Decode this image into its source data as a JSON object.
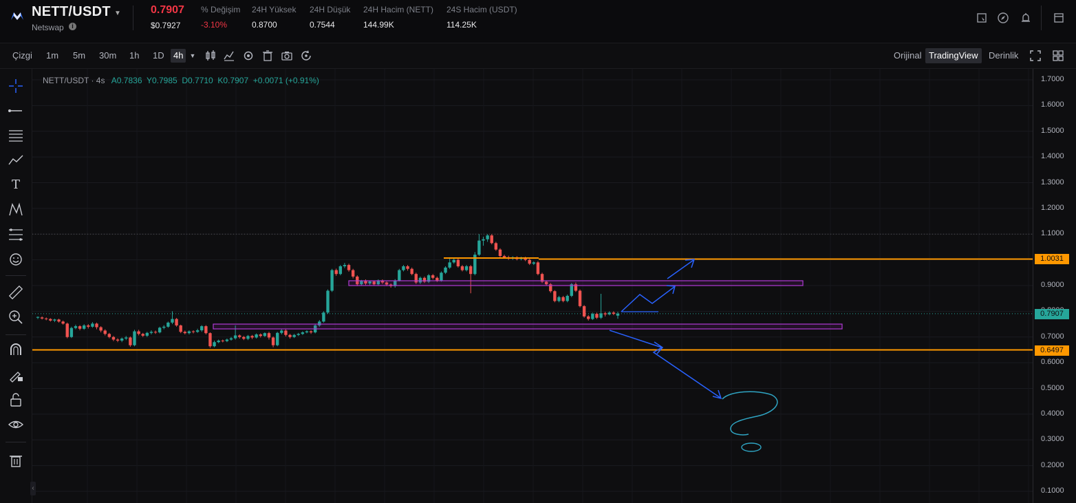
{
  "header": {
    "pair": "NETT/USDT",
    "exchange": "Netswap",
    "price": "0.7907",
    "price_usd": "$0.7927",
    "stats": [
      {
        "label": "% Değişim",
        "value": "-3.10%",
        "color": "#f23645"
      },
      {
        "label": "24H Yüksek",
        "value": "0.8700"
      },
      {
        "label": "24H Düşük",
        "value": "0.7544"
      },
      {
        "label": "24H Hacim (NETT)",
        "value": "144.99K"
      },
      {
        "label": "24S Hacim (USDT)",
        "value": "114.25K"
      }
    ]
  },
  "toolbar": {
    "chart_type": "Çizgi",
    "intervals": [
      "1m",
      "5m",
      "30m",
      "1h",
      "1D",
      "4h"
    ],
    "active_interval": "4h",
    "views": [
      "Orijinal",
      "TradingView",
      "Derinlik"
    ],
    "active_view": "TradingView"
  },
  "legend": {
    "symbol": "NETT/USDT · 4s",
    "open": "A0.7836",
    "high": "Y0.7985",
    "low": "D0.7710",
    "close": "K0.7907",
    "change": "+0.0071 (+0.91%)"
  },
  "chart_data": {
    "type": "candlestick",
    "y_ticks": [
      "1.7000",
      "1.6000",
      "1.5000",
      "1.4000",
      "1.3000",
      "1.2000",
      "1.1000",
      "1.0000",
      "0.9000",
      "0.8000",
      "0.7000",
      "0.6000",
      "0.5000",
      "0.4000",
      "0.3000",
      "0.2000",
      "0.1000"
    ],
    "ylim": [
      0.1,
      1.7
    ],
    "price_badges": [
      {
        "value": 1.0031,
        "label": "1.0031",
        "color": "#ff9800"
      },
      {
        "value": 0.7907,
        "label": "0.7907",
        "color": "#26a69a"
      },
      {
        "value": 0.6497,
        "label": "0.6497",
        "color": "#ff9800"
      }
    ],
    "candles": [
      [
        0.775,
        0.778,
        0.77,
        0.78
      ],
      [
        0.776,
        0.772,
        0.768,
        0.78
      ],
      [
        0.772,
        0.77,
        0.765,
        0.776
      ],
      [
        0.77,
        0.764,
        0.76,
        0.773
      ],
      [
        0.764,
        0.768,
        0.758,
        0.771
      ],
      [
        0.768,
        0.76,
        0.756,
        0.771
      ],
      [
        0.76,
        0.752,
        0.748,
        0.764
      ],
      [
        0.752,
        0.7,
        0.695,
        0.756
      ],
      [
        0.7,
        0.735,
        0.696,
        0.74
      ],
      [
        0.735,
        0.742,
        0.73,
        0.748
      ],
      [
        0.742,
        0.732,
        0.726,
        0.746
      ],
      [
        0.732,
        0.745,
        0.728,
        0.75
      ],
      [
        0.745,
        0.74,
        0.733,
        0.75
      ],
      [
        0.74,
        0.752,
        0.736,
        0.758
      ],
      [
        0.752,
        0.738,
        0.73,
        0.756
      ],
      [
        0.738,
        0.725,
        0.718,
        0.742
      ],
      [
        0.725,
        0.712,
        0.706,
        0.73
      ],
      [
        0.712,
        0.7,
        0.695,
        0.716
      ],
      [
        0.7,
        0.69,
        0.684,
        0.704
      ],
      [
        0.69,
        0.686,
        0.68,
        0.695
      ],
      [
        0.686,
        0.694,
        0.68,
        0.698
      ],
      [
        0.694,
        0.698,
        0.688,
        0.704
      ],
      [
        0.698,
        0.668,
        0.662,
        0.702
      ],
      [
        0.668,
        0.722,
        0.664,
        0.728
      ],
      [
        0.722,
        0.712,
        0.706,
        0.728
      ],
      [
        0.712,
        0.705,
        0.7,
        0.716
      ],
      [
        0.705,
        0.716,
        0.7,
        0.72
      ],
      [
        0.716,
        0.72,
        0.71,
        0.726
      ],
      [
        0.72,
        0.718,
        0.712,
        0.725
      ],
      [
        0.718,
        0.736,
        0.714,
        0.74
      ],
      [
        0.736,
        0.74,
        0.73,
        0.746
      ],
      [
        0.74,
        0.756,
        0.736,
        0.76
      ],
      [
        0.756,
        0.77,
        0.75,
        0.8
      ],
      [
        0.77,
        0.745,
        0.74,
        0.774
      ],
      [
        0.745,
        0.72,
        0.715,
        0.748
      ],
      [
        0.72,
        0.715,
        0.71,
        0.725
      ],
      [
        0.715,
        0.722,
        0.71,
        0.726
      ],
      [
        0.722,
        0.72,
        0.714,
        0.726
      ],
      [
        0.72,
        0.726,
        0.716,
        0.732
      ],
      [
        0.726,
        0.742,
        0.72,
        0.746
      ],
      [
        0.742,
        0.715,
        0.71,
        0.746
      ],
      [
        0.715,
        0.664,
        0.658,
        0.718
      ],
      [
        0.664,
        0.68,
        0.66,
        0.686
      ],
      [
        0.68,
        0.686,
        0.676,
        0.69
      ],
      [
        0.686,
        0.684,
        0.679,
        0.69
      ],
      [
        0.684,
        0.69,
        0.68,
        0.694
      ],
      [
        0.69,
        0.695,
        0.686,
        0.7
      ],
      [
        0.695,
        0.706,
        0.69,
        0.745
      ],
      [
        0.706,
        0.7,
        0.694,
        0.71
      ],
      [
        0.7,
        0.693,
        0.688,
        0.704
      ],
      [
        0.693,
        0.704,
        0.688,
        0.708
      ],
      [
        0.704,
        0.698,
        0.692,
        0.708
      ],
      [
        0.698,
        0.71,
        0.694,
        0.714
      ],
      [
        0.71,
        0.704,
        0.698,
        0.714
      ],
      [
        0.704,
        0.715,
        0.7,
        0.718
      ],
      [
        0.715,
        0.698,
        0.69,
        0.72
      ],
      [
        0.698,
        0.668,
        0.66,
        0.702
      ],
      [
        0.668,
        0.716,
        0.664,
        0.72
      ],
      [
        0.716,
        0.725,
        0.71,
        0.73
      ],
      [
        0.725,
        0.708,
        0.702,
        0.73
      ],
      [
        0.708,
        0.7,
        0.694,
        0.712
      ],
      [
        0.7,
        0.708,
        0.696,
        0.712
      ],
      [
        0.708,
        0.712,
        0.704,
        0.716
      ],
      [
        0.712,
        0.718,
        0.708,
        0.722
      ],
      [
        0.718,
        0.722,
        0.714,
        0.726
      ],
      [
        0.722,
        0.718,
        0.712,
        0.726
      ],
      [
        0.718,
        0.745,
        0.714,
        0.75
      ],
      [
        0.745,
        0.76,
        0.74,
        0.766
      ],
      [
        0.76,
        0.795,
        0.756,
        0.8
      ],
      [
        0.795,
        0.88,
        0.79,
        0.885
      ],
      [
        0.88,
        0.96,
        0.875,
        0.965
      ],
      [
        0.96,
        0.945,
        0.938,
        0.966
      ],
      [
        0.945,
        0.975,
        0.94,
        0.98
      ],
      [
        0.975,
        0.98,
        0.968,
        0.988
      ],
      [
        0.98,
        0.96,
        0.954,
        0.985
      ],
      [
        0.96,
        0.935,
        0.928,
        0.965
      ],
      [
        0.935,
        0.905,
        0.898,
        0.94
      ],
      [
        0.905,
        0.918,
        0.9,
        0.922
      ],
      [
        0.918,
        0.908,
        0.902,
        0.924
      ],
      [
        0.908,
        0.916,
        0.902,
        0.92
      ],
      [
        0.916,
        0.905,
        0.9,
        0.92
      ],
      [
        0.905,
        0.92,
        0.9,
        0.924
      ],
      [
        0.92,
        0.912,
        0.906,
        0.924
      ],
      [
        0.912,
        0.904,
        0.898,
        0.916
      ],
      [
        0.904,
        0.898,
        0.892,
        0.908
      ],
      [
        0.898,
        0.92,
        0.892,
        0.925
      ],
      [
        0.92,
        0.96,
        0.916,
        0.965
      ],
      [
        0.96,
        0.975,
        0.955,
        0.98
      ],
      [
        0.975,
        0.965,
        0.958,
        0.98
      ],
      [
        0.965,
        0.945,
        0.94,
        0.97
      ],
      [
        0.945,
        0.912,
        0.906,
        0.95
      ],
      [
        0.912,
        0.93,
        0.906,
        0.935
      ],
      [
        0.93,
        0.915,
        0.91,
        0.935
      ],
      [
        0.915,
        0.94,
        0.91,
        0.945
      ],
      [
        0.94,
        0.93,
        0.924,
        0.945
      ],
      [
        0.93,
        0.92,
        0.914,
        0.935
      ],
      [
        0.92,
        0.95,
        0.915,
        0.955
      ],
      [
        0.95,
        0.97,
        0.945,
        0.975
      ],
      [
        0.97,
        0.99,
        0.965,
        1.01
      ],
      [
        0.99,
        1.0,
        0.985,
        1.005
      ],
      [
        1.0,
        0.975,
        0.97,
        1.005
      ],
      [
        0.975,
        0.96,
        0.955,
        0.98
      ],
      [
        0.96,
        0.975,
        0.955,
        0.98
      ],
      [
        0.975,
        0.945,
        0.87,
        0.98
      ],
      [
        0.945,
        1.02,
        0.94,
        1.03
      ],
      [
        1.02,
        1.075,
        1.015,
        1.1
      ],
      [
        1.075,
        1.08,
        1.055,
        1.09
      ],
      [
        1.08,
        1.095,
        1.07,
        1.1
      ],
      [
        1.095,
        1.065,
        1.06,
        1.1
      ],
      [
        1.065,
        1.04,
        1.035,
        1.07
      ],
      [
        1.04,
        1.015,
        1.01,
        1.045
      ],
      [
        1.015,
        1.01,
        1.005,
        1.02
      ],
      [
        1.01,
        1.005,
        1.0,
        1.016
      ],
      [
        1.005,
        1.01,
        1.0,
        1.014
      ],
      [
        1.01,
        1.003,
        0.998,
        1.014
      ],
      [
        1.003,
        1.008,
        0.998,
        1.012
      ],
      [
        1.008,
        1.0,
        0.995,
        1.012
      ],
      [
        1.0,
        0.985,
        0.98,
        1.004
      ],
      [
        0.985,
        0.99,
        0.98,
        0.994
      ],
      [
        0.99,
        0.945,
        0.94,
        0.995
      ],
      [
        0.945,
        0.915,
        0.91,
        0.95
      ],
      [
        0.915,
        0.905,
        0.9,
        0.92
      ],
      [
        0.905,
        0.878,
        0.872,
        0.91
      ],
      [
        0.878,
        0.84,
        0.835,
        0.882
      ],
      [
        0.84,
        0.855,
        0.835,
        0.86
      ],
      [
        0.855,
        0.84,
        0.835,
        0.86
      ],
      [
        0.84,
        0.86,
        0.835,
        0.865
      ],
      [
        0.86,
        0.905,
        0.855,
        0.91
      ],
      [
        0.905,
        0.88,
        0.875,
        0.912
      ],
      [
        0.88,
        0.82,
        0.815,
        0.885
      ],
      [
        0.82,
        0.78,
        0.775,
        0.824
      ],
      [
        0.78,
        0.77,
        0.764,
        0.785
      ],
      [
        0.77,
        0.79,
        0.766,
        0.795
      ],
      [
        0.79,
        0.775,
        0.77,
        0.795
      ],
      [
        0.775,
        0.792,
        0.77,
        0.868
      ],
      [
        0.792,
        0.788,
        0.78,
        0.798
      ],
      [
        0.788,
        0.795,
        0.784,
        0.8
      ],
      [
        0.795,
        0.79,
        0.785,
        0.8
      ],
      [
        0.783,
        0.791,
        0.771,
        0.798
      ]
    ]
  }
}
